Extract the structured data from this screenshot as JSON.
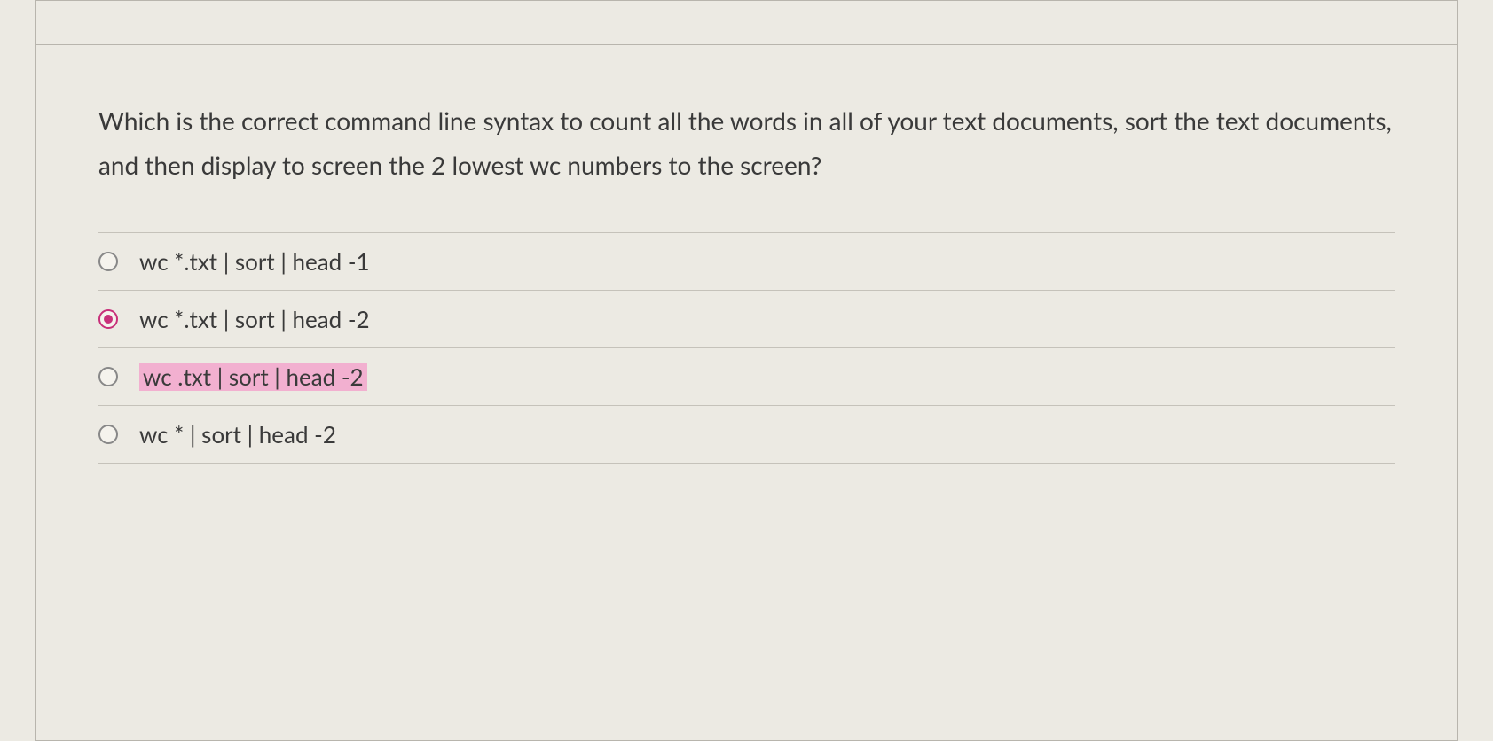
{
  "question": {
    "text": "Which is the correct command line syntax to count all the words in all of your text documents, sort the text documents, and then display to screen the 2 lowest wc numbers to the screen?"
  },
  "options": [
    {
      "label": "wc *.txt | sort | head -1",
      "selected": false,
      "highlighted": false
    },
    {
      "label": "wc *.txt | sort | head -2",
      "selected": true,
      "highlighted": false
    },
    {
      "label": "wc .txt | sort | head -2",
      "selected": false,
      "highlighted": true
    },
    {
      "label": "wc * | sort | head -2",
      "selected": false,
      "highlighted": false
    }
  ]
}
